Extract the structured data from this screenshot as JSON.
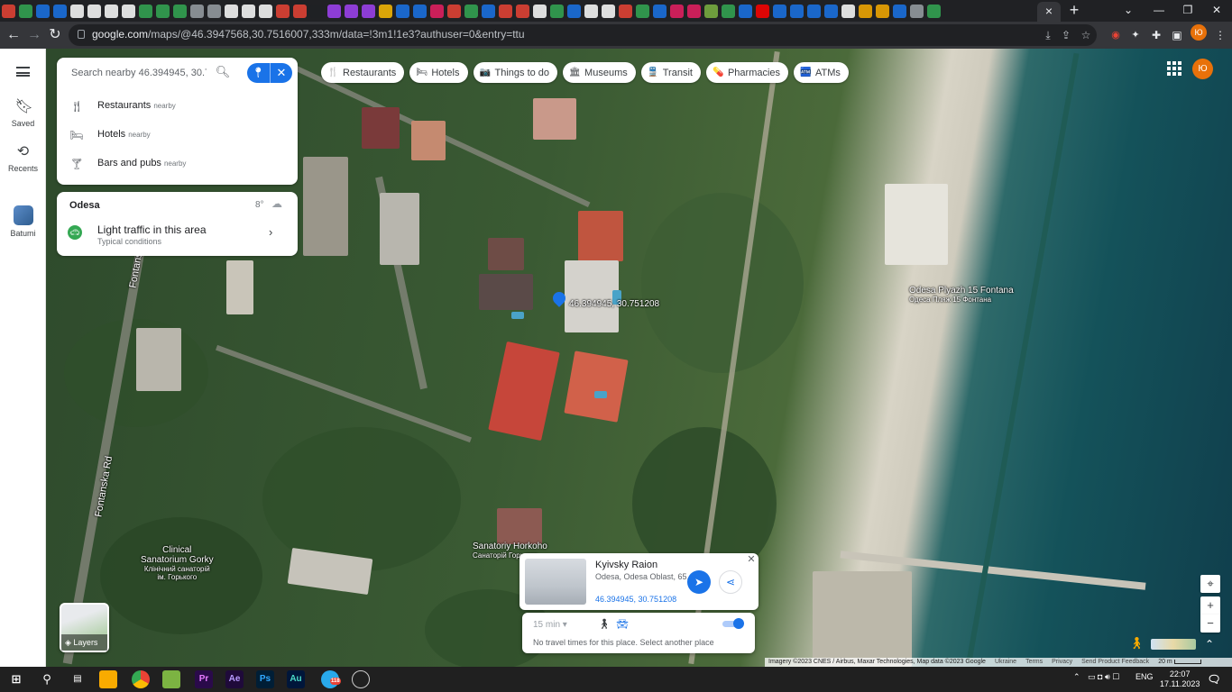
{
  "browser": {
    "tab_favicon_colors": [
      "#ea4335",
      "#34a853",
      "#1a73e8",
      "#1a73e8",
      "#ffffff",
      "#ffffff",
      "#ffffff",
      "#ffffff",
      "#34a853",
      "#34a853",
      "#34a853",
      "#9aa0a6",
      "#9aa0a6",
      "#ffffff",
      "#ffffff",
      "#ffffff",
      "#ea4335",
      "#ea4335",
      "#202124",
      "#a142f4",
      "#a142f4",
      "#a142f4",
      "#fbbc04",
      "#1a73e8",
      "#1a73e8",
      "#e91e63",
      "#ea4335",
      "#34a853",
      "#1a73e8",
      "#ea4335",
      "#ea4335",
      "#ffffff",
      "#34a853",
      "#1a73e8",
      "#ffffff",
      "#ffffff",
      "#ea4335",
      "#34a853",
      "#1a73e8",
      "#e91e63",
      "#e91e63",
      "#7cb342",
      "#34a853",
      "#1a73e8",
      "#ff0000",
      "#1a73e8",
      "#1a73e8",
      "#1a73e8",
      "#1a73e8",
      "#ffffff",
      "#f9ab00",
      "#f9ab00",
      "#1a73e8",
      "#9aa0a6",
      "#34a853"
    ],
    "active_tab_close": "×",
    "new_tab": "+",
    "url_host": "google.com",
    "url_path": "/maps/@46.3947568,30.7516007,333m/data=!3m1!1e3?authuser=0&entry=ttu",
    "profile_initials": "Ю"
  },
  "rail": {
    "saved_label": "Saved",
    "recents_label": "Recents",
    "batumi_label": "Batumi"
  },
  "search": {
    "placeholder": "Search nearby 46.394945, 30.751",
    "suggestions": [
      {
        "label": "Restaurants",
        "sub": "nearby",
        "icon": "fork-knife-icon"
      },
      {
        "label": "Hotels",
        "sub": "nearby",
        "icon": "bed-icon"
      },
      {
        "label": "Bars and pubs",
        "sub": "nearby",
        "icon": "cocktail-icon"
      }
    ]
  },
  "weather": {
    "city": "Odesa",
    "temperature": "8°",
    "traffic_title": "Light traffic in this area",
    "traffic_sub": "Typical conditions"
  },
  "chips": [
    {
      "label": "Restaurants",
      "icon": "fork-knife-icon",
      "glyph": "🍴"
    },
    {
      "label": "Hotels",
      "icon": "bed-icon",
      "glyph": "🛏"
    },
    {
      "label": "Things to do",
      "icon": "camera-icon",
      "glyph": "📷"
    },
    {
      "label": "Museums",
      "icon": "museum-icon",
      "glyph": "🏛"
    },
    {
      "label": "Transit",
      "icon": "transit-icon",
      "glyph": "🚆"
    },
    {
      "label": "Pharmacies",
      "icon": "pharmacy-icon",
      "glyph": "💊"
    },
    {
      "label": "ATMs",
      "icon": "atm-icon",
      "glyph": "🏧"
    }
  ],
  "account_initials": "Ю",
  "map": {
    "pin_label": "46.394945, 30.751208",
    "beach_name": "Odesa Plyazh 15 Fontana",
    "beach_name_local": "Одеса Пляж 15 Фонтана",
    "sanatorium_name": "Sanatoriy Horkoho",
    "sanatorium_local": "Санаторій Горького",
    "clinical_name_1": "Clinical",
    "clinical_name_2": "Sanatorium Gorky",
    "clinical_local_1": "Клінічний санаторій",
    "clinical_local_2": "ім. Горького",
    "road_name": "Fontanska Rd",
    "road_name_2": "Fontans",
    "road_name_3": "Fontanska Rd"
  },
  "layers_label": "Layers",
  "place": {
    "name": "Kyivsky Raion",
    "address": "Odesa, Odesa Oblast, 65...",
    "coords": "46.394945, 30.751208"
  },
  "travel": {
    "time": "15 min",
    "message": "No travel times for this place. Select another place"
  },
  "attribution": {
    "imagery": "Imagery ©2023 CNES / Airbus, Maxar Technologies, Map data ©2023 Google",
    "region": "Ukraine",
    "terms": "Terms",
    "privacy": "Privacy",
    "feedback": "Send Product Feedback",
    "scale": "20 m"
  },
  "taskbar": {
    "lang": "ENG",
    "time": "22:07",
    "date": "17.11.2023",
    "telegram_badge": "118"
  }
}
